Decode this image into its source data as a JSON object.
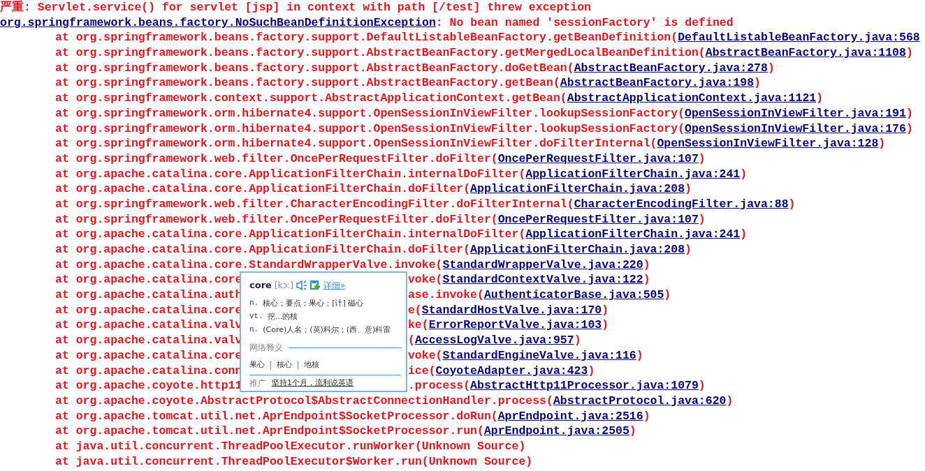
{
  "header": {
    "level": "严重:",
    "message": "Servlet.service() for servlet [jsp] in context with path [/test] threw exception"
  },
  "exception": {
    "class": "org.springframework.beans.factory.NoSuchBeanDefinitionException",
    "message": ": No bean named 'sessionFactory' is defined"
  },
  "frames": [
    {
      "call": "at org.springframework.beans.factory.support.DefaultListableBeanFactory.getBeanDefinition(",
      "source": "DefaultListableBeanFactory.java:568"
    },
    {
      "call": "at org.springframework.beans.factory.support.AbstractBeanFactory.getMergedLocalBeanDefinition(",
      "source": "AbstractBeanFactory.java:1108",
      "close": ")"
    },
    {
      "call": "at org.springframework.beans.factory.support.AbstractBeanFactory.doGetBean(",
      "source": "AbstractBeanFactory.java:278",
      "close": ")"
    },
    {
      "call": "at org.springframework.beans.factory.support.AbstractBeanFactory.getBean(",
      "source": "AbstractBeanFactory.java:198",
      "close": ")"
    },
    {
      "call": "at org.springframework.context.support.AbstractApplicationContext.getBean(",
      "source": "AbstractApplicationContext.java:1121",
      "close": ")"
    },
    {
      "call": "at org.springframework.orm.hibernate4.support.OpenSessionInViewFilter.lookupSessionFactory(",
      "source": "OpenSessionInViewFilter.java:191",
      "close": ")"
    },
    {
      "call": "at org.springframework.orm.hibernate4.support.OpenSessionInViewFilter.lookupSessionFactory(",
      "source": "OpenSessionInViewFilter.java:176",
      "close": ")"
    },
    {
      "call": "at org.springframework.orm.hibernate4.support.OpenSessionInViewFilter.doFilterInternal(",
      "source": "OpenSessionInViewFilter.java:128",
      "close": ")"
    },
    {
      "call": "at org.springframework.web.filter.OncePerRequestFilter.doFilter(",
      "source": "OncePerRequestFilter.java:107",
      "close": ")"
    },
    {
      "call": "at org.apache.catalina.core.ApplicationFilterChain.internalDoFilter(",
      "source": "ApplicationFilterChain.java:241",
      "close": ")"
    },
    {
      "call": "at org.apache.catalina.core.ApplicationFilterChain.doFilter(",
      "source": "ApplicationFilterChain.java:208",
      "close": ")"
    },
    {
      "call": "at org.springframework.web.filter.CharacterEncodingFilter.doFilterInternal(",
      "source": "CharacterEncodingFilter.java:88",
      "close": ")"
    },
    {
      "call": "at org.springframework.web.filter.OncePerRequestFilter.doFilter(",
      "source": "OncePerRequestFilter.java:107",
      "close": ")"
    },
    {
      "call": "at org.apache.catalina.core.ApplicationFilterChain.internalDoFilter(",
      "source": "ApplicationFilterChain.java:241",
      "close": ")"
    },
    {
      "call": "at org.apache.catalina.core.ApplicationFilterChain.doFilter(",
      "source": "ApplicationFilterChain.java:208",
      "close": ")"
    },
    {
      "call": "at org.apache.catalina.core.StandardWrapperValve.invoke(",
      "source": "StandardWrapperValve.java:220",
      "close": ")"
    },
    {
      "call": "at org.apache.catalina.core",
      "call_after": "voke(",
      "source": "StandardContextValve.java:122",
      "close": ")"
    },
    {
      "call": "at org.apache.catalina.auth",
      "call_after": "ase.invoke(",
      "source": "AuthenticatorBase.java:505",
      "close": ")"
    },
    {
      "call": "at org.apache.catalina.core",
      "call_after": "e(",
      "source": "StandardHostValve.java:170",
      "close": ")"
    },
    {
      "call": "at org.apache.catalina.valv",
      "call_after": "ke(",
      "source": "ErrorReportValve.java:103",
      "close": ")"
    },
    {
      "call": "at org.apache.catalina.valv",
      "call_after": "(",
      "source": "AccessLogValve.java:957",
      "close": ")"
    },
    {
      "call": "at org.apache.catalina.core",
      "call_after": "voke(",
      "source": "StandardEngineValve.java:116",
      "close": ")"
    },
    {
      "call": "at org.apache.catalina.conn",
      "call_after": "ice(",
      "source": "CoyoteAdapter.java:423",
      "close": ")"
    },
    {
      "call": "at org.apache.coyote.http11",
      "call_after": ".process(",
      "source": "AbstractHttp11Processor.java:1079",
      "close": ")"
    },
    {
      "call": "at org.apache.coyote.AbstractProtocol$AbstractConnectionHandler.process(",
      "source": "AbstractProtocol.java:620",
      "close": ")"
    },
    {
      "call": "at org.apache.tomcat.util.net.AprEndpoint$SocketProcessor.doRun(",
      "source": "AprEndpoint.java:2516",
      "close": ")"
    },
    {
      "call": "at org.apache.tomcat.util.net.AprEndpoint$SocketProcessor.run(",
      "source": "AprEndpoint.java:2505",
      "close": ")"
    },
    {
      "call": "at java.util.concurrent.ThreadPoolExecutor.runWorker(Unknown Source)"
    },
    {
      "call": "at java.util.concurrent.ThreadPoolExecutor$Worker.run(Unknown Source)"
    }
  ],
  "popup": {
    "word": "core",
    "phonetic": "[kɔː]",
    "detail_link": "详细»",
    "definitions": [
      {
        "pos": "n.",
        "text": "核心；要点；果心；[计] 磁心"
      },
      {
        "pos": "vt.",
        "text": "挖...的核"
      },
      {
        "pos": "n.",
        "text": "(Core)人名；(英)科尔；(西、意)科雷"
      }
    ],
    "web_heading": "网络释义",
    "web_terms": [
      "果心",
      "核心",
      "地核"
    ],
    "promo_label": "推广",
    "promo_link": "坚持1个月，流利说英语"
  }
}
